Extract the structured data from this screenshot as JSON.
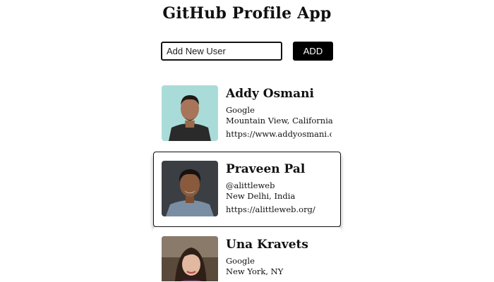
{
  "app": {
    "title": "GitHub Profile App"
  },
  "add_form": {
    "input_value": "",
    "input_placeholder": "Add New User",
    "button_label": "ADD"
  },
  "profiles": [
    {
      "name": "Addy Osmani",
      "company": "Google",
      "location": "Mountain View, California",
      "url": "https://www.addyosmani.com"
    },
    {
      "name": "Praveen Pal",
      "company": "@alittleweb",
      "location": "New Delhi, India",
      "url": "https://alittleweb.org/"
    },
    {
      "name": "Una Kravets",
      "company": "Google",
      "location": "New York, NY",
      "url": ""
    }
  ],
  "colors": {
    "accent": "#000000",
    "avatar_bg_1": "#a9dcd9",
    "avatar_bg_2": "#3b3f44",
    "avatar_bg_3": "#5a4a3c"
  }
}
